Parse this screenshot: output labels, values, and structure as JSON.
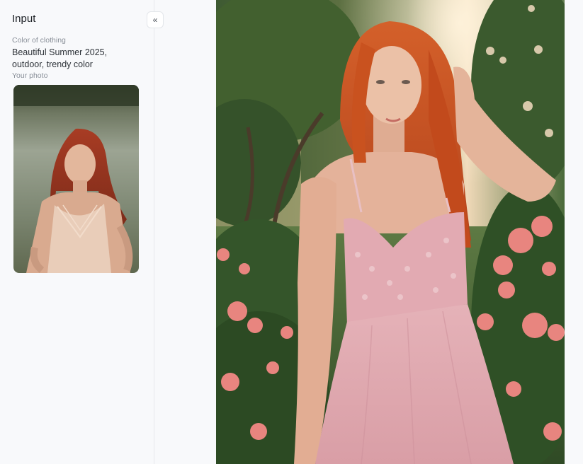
{
  "panel": {
    "title": "Input",
    "collapse_icon": "double-chevron-left-icon"
  },
  "fields": {
    "color_label": "Color of clothing",
    "color_value": "Beautiful Summer 2025, outdoor, trendy color",
    "photo_label": "Your photo"
  },
  "images": {
    "thumbnail": "input-photo: red-haired woman in light dress sitting outdoors",
    "result": "generated photo: red-haired woman in pink lace dress in rose garden"
  },
  "colors": {
    "background": "#f8f9fb",
    "border": "#e6e8ec",
    "label": "#8a9099",
    "dress": "#e8b6bc",
    "hair": "#c8501f",
    "foliage": "#3d5a2e",
    "roses": "#e8827e"
  }
}
